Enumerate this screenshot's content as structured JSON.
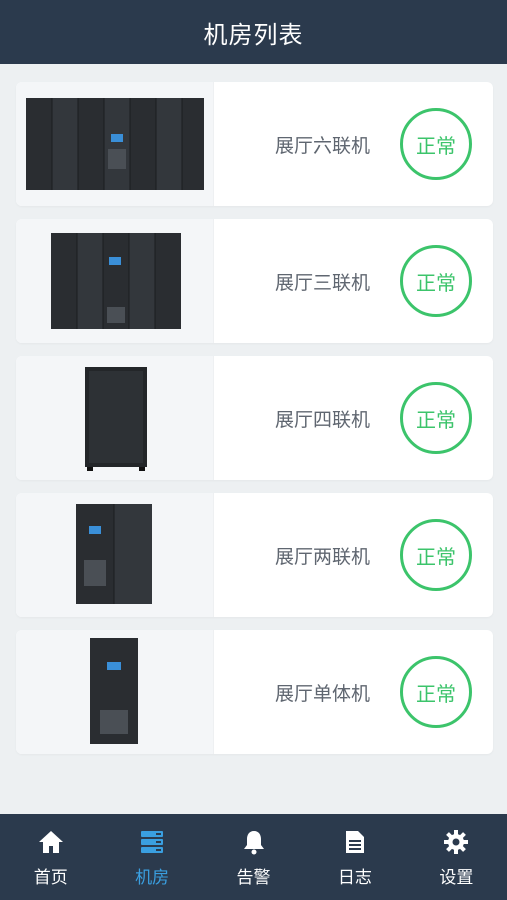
{
  "header": {
    "title": "机房列表"
  },
  "rooms": [
    {
      "name": "展厅六联机",
      "status": "正常",
      "racks": 7
    },
    {
      "name": "展厅三联机",
      "status": "正常",
      "racks": 5
    },
    {
      "name": "展厅四联机",
      "status": "正常",
      "racks": 1
    },
    {
      "name": "展厅两联机",
      "status": "正常",
      "racks": 2
    },
    {
      "name": "展厅单体机",
      "status": "正常",
      "racks": 1
    }
  ],
  "tabs": [
    {
      "label": "首页",
      "icon": "home-icon",
      "active": false
    },
    {
      "label": "机房",
      "icon": "server-icon",
      "active": true
    },
    {
      "label": "告警",
      "icon": "bell-icon",
      "active": false
    },
    {
      "label": "日志",
      "icon": "document-icon",
      "active": false
    },
    {
      "label": "设置",
      "icon": "gear-icon",
      "active": false
    }
  ],
  "colors": {
    "header_bg": "#2b3a4d",
    "status_green": "#3cc46b",
    "tab_active": "#3a9fe0"
  }
}
